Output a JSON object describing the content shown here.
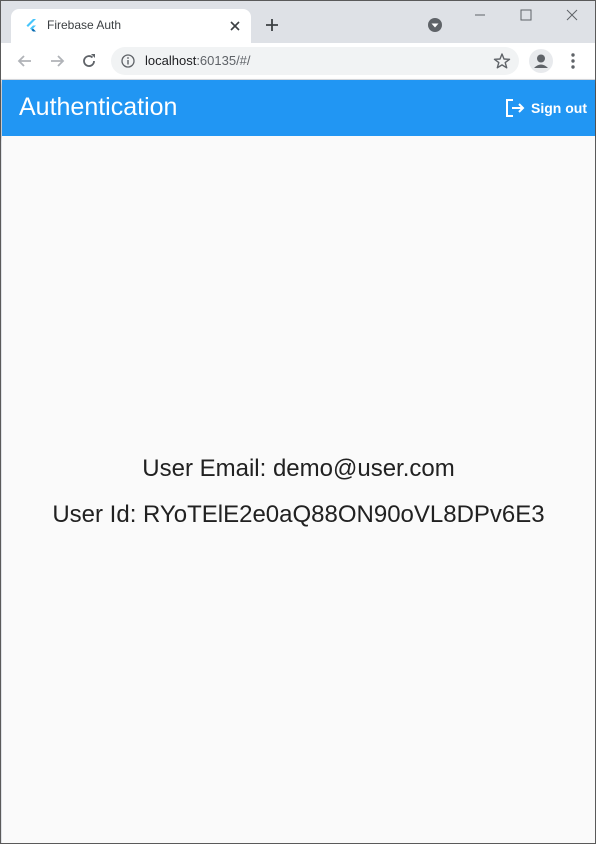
{
  "browser": {
    "tab": {
      "title": "Firebase Auth",
      "favicon": "flutter-icon"
    },
    "url": {
      "host": "localhost",
      "rest": ":60135/#/"
    }
  },
  "appbar": {
    "title": "Authentication",
    "sign_out_label": "Sign out",
    "color": "#2196f3"
  },
  "user": {
    "email_line": "User Email: demo@user.com",
    "id_line": "User Id: RYoTElE2e0aQ88ON90oVL8DPv6E3"
  }
}
